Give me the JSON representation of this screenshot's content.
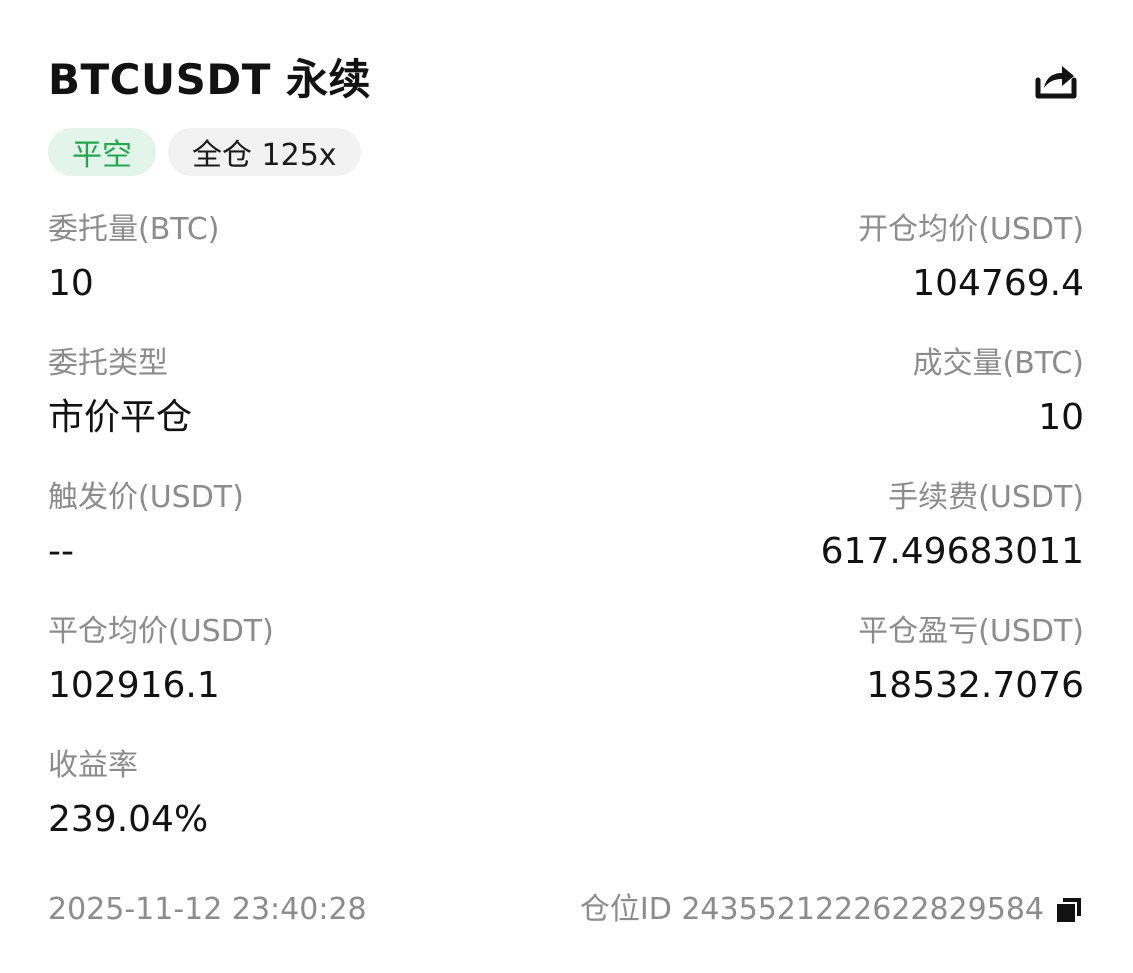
{
  "header": {
    "title": "BTCUSDT 永续",
    "share_icon": "share-icon"
  },
  "badges": {
    "side": "平空",
    "margin": "全仓 125x",
    "side_color": "#22a74f",
    "side_bg": "#e3f5ea"
  },
  "fields": {
    "order_qty": {
      "label": "委托量(BTC)",
      "value": "10"
    },
    "open_avg_price": {
      "label": "开仓均价(USDT)",
      "value": "104769.4"
    },
    "order_type": {
      "label": "委托类型",
      "value": "市价平仓"
    },
    "filled_qty": {
      "label": "成交量(BTC)",
      "value": "10"
    },
    "trigger_price": {
      "label": "触发价(USDT)",
      "value": "--"
    },
    "fee": {
      "label": "手续费(USDT)",
      "value": "617.49683011"
    },
    "close_avg_price": {
      "label": "平仓均价(USDT)",
      "value": "102916.1"
    },
    "close_pnl": {
      "label": "平仓盈亏(USDT)",
      "value": "18532.7076"
    },
    "roi": {
      "label": "收益率",
      "value": "239.04%"
    }
  },
  "footer": {
    "timestamp": "2025-11-12 23:40:28",
    "position_id_label": "仓位ID 2435521222622829584",
    "copy_icon": "copy-icon"
  }
}
